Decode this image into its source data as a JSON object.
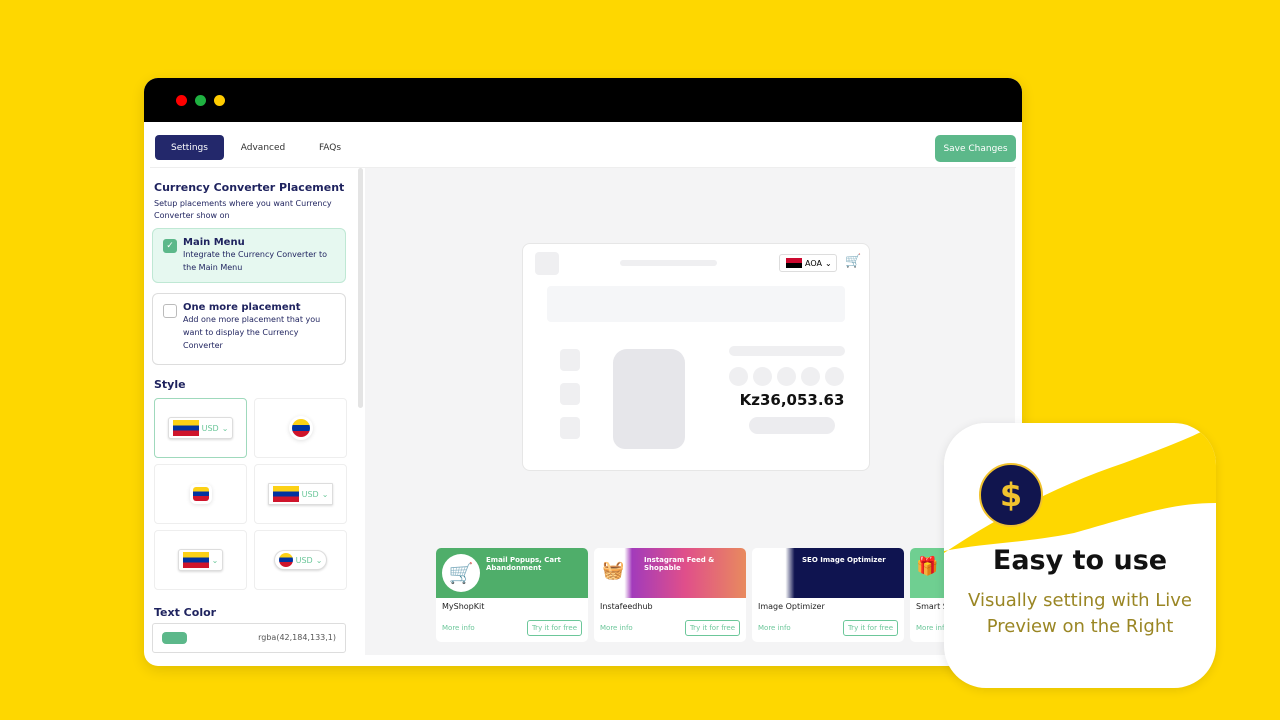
{
  "window": {
    "dots": [
      "#ff0000",
      "#1fb141",
      "#ffcc00"
    ]
  },
  "tabs": [
    {
      "label": "Settings",
      "active": true
    },
    {
      "label": "Advanced"
    },
    {
      "label": "FAQs"
    }
  ],
  "save_label": "Save Changes",
  "placement": {
    "title": "Currency Converter Placement",
    "subtitle": "Setup placements where you want Currency Converter show on",
    "options": [
      {
        "title": "Main Menu",
        "desc": "Integrate the Currency Converter to the Main Menu",
        "checked": true
      },
      {
        "title": "One more placement",
        "desc": "Add one more placement that you want to display the Currency Converter",
        "checked": false
      }
    ]
  },
  "style": {
    "title": "Style",
    "currency": "USD"
  },
  "text_color": {
    "title": "Text Color",
    "value": "rgba(42,184,133,1)",
    "swatch": "#5cb88a"
  },
  "preview": {
    "currency": "AOA",
    "price": "Kz36,053.63"
  },
  "apps": [
    {
      "banner": "Email Popups, Cart Abandonment",
      "name": "MyShopKit",
      "more": "More info",
      "try": "Try it for free"
    },
    {
      "banner": "Instagram Feed & Shopable",
      "name": "Instafeedhub",
      "more": "More info",
      "try": "Try it for free"
    },
    {
      "banner": "SEO Image Optimizer",
      "name": "Image Optimizer",
      "more": "More info",
      "try": "Try it for free"
    },
    {
      "banner": "",
      "name": "Smart S",
      "more": "More inf",
      "try": ""
    }
  ],
  "promo": {
    "title": "Easy to use",
    "text": "Visually setting with Live Preview on the Right"
  }
}
